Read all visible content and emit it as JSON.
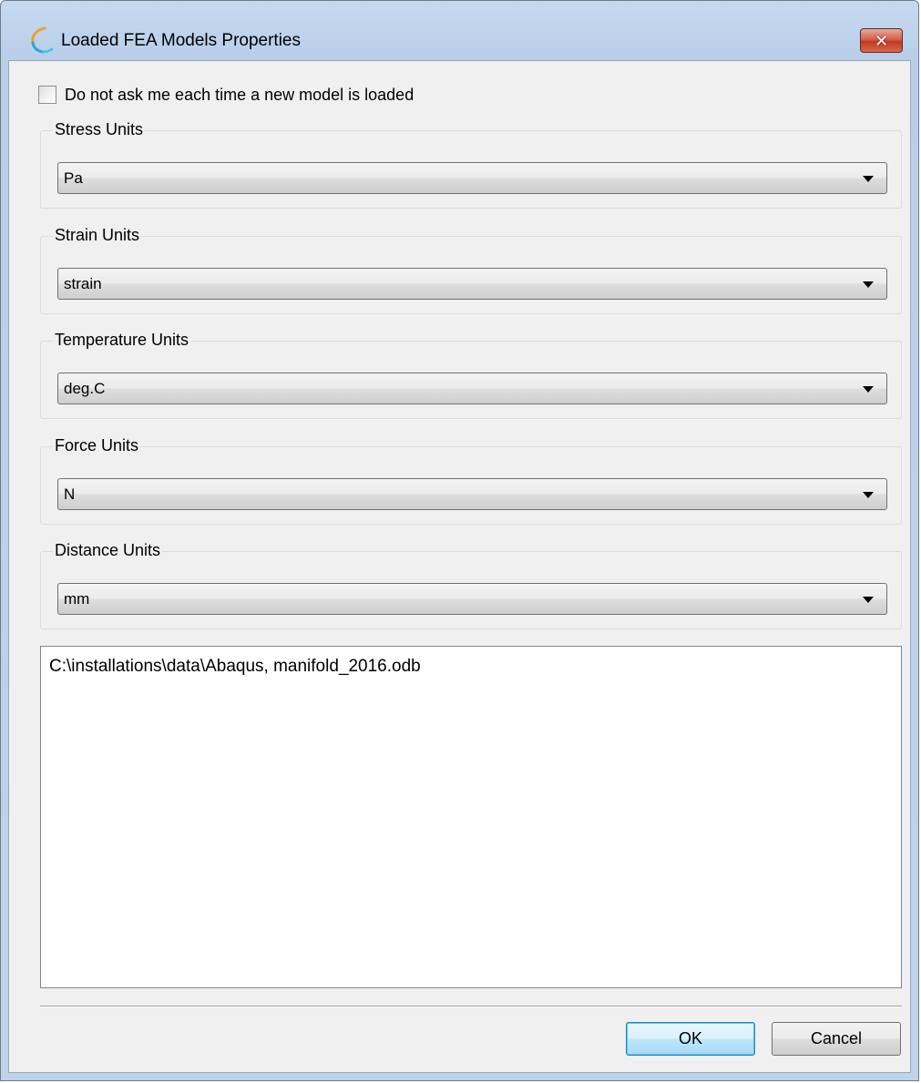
{
  "window": {
    "title": "Loaded FEA Models Properties",
    "close_label": "✕"
  },
  "checkbox": {
    "label": "Do not ask me each time a new model is loaded",
    "checked": false
  },
  "groups": [
    {
      "label": "Stress Units",
      "value": "Pa"
    },
    {
      "label": "Strain Units",
      "value": "strain"
    },
    {
      "label": "Temperature Units",
      "value": "deg.C"
    },
    {
      "label": "Force Units",
      "value": "N"
    },
    {
      "label": "Distance Units",
      "value": "mm"
    }
  ],
  "model_list": {
    "text": "C:\\installations\\data\\Abaqus, manifold_2016.odb"
  },
  "buttons": {
    "ok": "OK",
    "cancel": "Cancel"
  },
  "colors": {
    "close_button": "#c23b21",
    "ok_border": "#3c7fb1",
    "dialog_background": "#f0f0f0"
  },
  "icons": {
    "app": "app-logo-icon",
    "close": "close-icon",
    "dropdown": "chevron-down-icon"
  }
}
